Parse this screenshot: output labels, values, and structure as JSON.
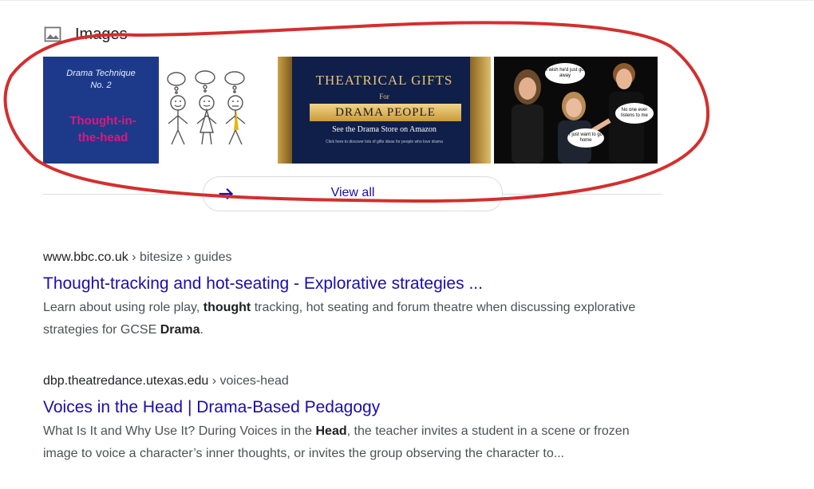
{
  "images_section": {
    "title": "Images",
    "thumbs": [
      {
        "caption_line1": "Drama Technique",
        "caption_line2": "No. 2",
        "big_line1": "Thought-in-",
        "big_line2": "the-head"
      },
      {
        "title": "THEATRICAL  GIFTS",
        "for_text": "For",
        "banner": "DRAMA  PEOPLE",
        "subtitle": "See the Drama Store on Amazon",
        "tiny": "Click here to discover lots of gifts ideas for people who love drama"
      },
      {
        "bubble1": "I wish he'd just go away",
        "bubble2": "No one ever listens to me",
        "bubble3": "I just want to go home"
      }
    ],
    "view_all": "View all"
  },
  "results": [
    {
      "domain": "www.bbc.co.uk",
      "path": " › bitesize › guides",
      "title": "Thought-tracking and hot-seating - Explorative strategies ...",
      "snippet_parts": [
        "Learn about using role play, ",
        "thought",
        " tracking, hot seating and forum theatre when discussing explorative strategies for GCSE ",
        "Drama",
        "."
      ]
    },
    {
      "domain": "dbp.theatredance.utexas.edu",
      "path": " › voices-head",
      "title": "Voices in the Head | Drama-Based Pedagogy",
      "snippet_parts": [
        "What Is It and Why Use It? During Voices in the ",
        "Head",
        ", the teacher invites a student in a scene or frozen image to voice a character’s inner thoughts, or invites the group observing the character to..."
      ]
    }
  ],
  "colors": {
    "link": "#1a0dab",
    "annotation": "#d32f2f"
  }
}
